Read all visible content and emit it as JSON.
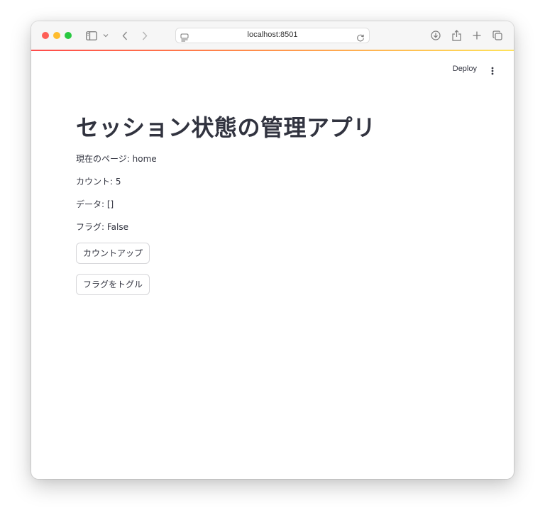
{
  "browser": {
    "url": "localhost:8501"
  },
  "app_header": {
    "deploy_label": "Deploy"
  },
  "main": {
    "title": "セッション状態の管理アプリ",
    "lines": [
      "現在のページ: home",
      "カウント: 5",
      "データ: []",
      "フラグ: False"
    ],
    "buttons": [
      "カウントアップ",
      "フラグをトグル"
    ]
  },
  "colors": {
    "text": "#31333f",
    "accent_red": "#ff4b4b",
    "accent_yellow": "#ffe35a",
    "traffic_close": "#fe5f57",
    "traffic_min": "#febc2e",
    "traffic_max": "#28c840"
  },
  "icons": [
    "sidebar-icon",
    "chevron-down-icon",
    "back-arrow-icon",
    "forward-arrow-icon",
    "page-settings-icon",
    "reload-icon",
    "download-icon",
    "share-icon",
    "new-tab-icon",
    "tabs-overview-icon",
    "kebab-menu-icon"
  ]
}
